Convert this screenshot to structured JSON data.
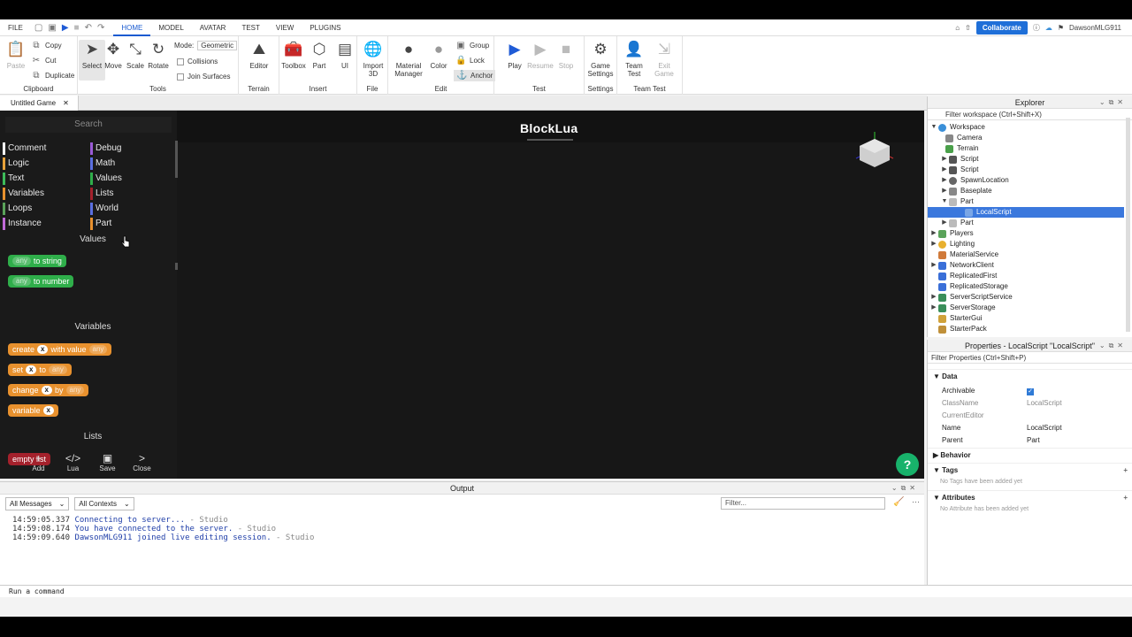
{
  "menubar": {
    "file": "FILE",
    "tabs": [
      "HOME",
      "MODEL",
      "AVATAR",
      "TEST",
      "VIEW",
      "PLUGINS"
    ],
    "collaborate": "Collaborate",
    "username": "DawsonMLG911"
  },
  "ribbon": {
    "clipboard": {
      "label": "Clipboard",
      "paste": "Paste",
      "copy": "Copy",
      "cut": "Cut",
      "duplicate": "Duplicate"
    },
    "tools": {
      "label": "Tools",
      "select": "Select",
      "move": "Move",
      "scale": "Scale",
      "rotate": "Rotate",
      "mode_label": "Mode:",
      "mode_value": "Geometric",
      "collisions": "Collisions",
      "join_surfaces": "Join Surfaces"
    },
    "terrain": {
      "label": "Terrain",
      "editor": "Editor"
    },
    "insert": {
      "label": "Insert",
      "toolbox": "Toolbox",
      "part": "Part",
      "ui": "UI"
    },
    "file": {
      "label": "File",
      "import3d": "Import 3D"
    },
    "edit": {
      "label": "Edit",
      "material_manager": "Material Manager",
      "color": "Color",
      "group": "Group",
      "lock": "Lock",
      "anchor": "Anchor"
    },
    "test": {
      "label": "Test",
      "play": "Play",
      "resume": "Resume",
      "stop": "Stop"
    },
    "settings": {
      "label": "Settings",
      "game_settings": "Game Settings"
    },
    "team_test": {
      "label": "Team Test",
      "team_test": "Team Test",
      "exit_game": "Exit Game"
    }
  },
  "doc_tab": {
    "title": "Untitled Game"
  },
  "viewport": {
    "title": "BlockLua",
    "search_placeholder": "Search",
    "categories": [
      {
        "name": "Comment",
        "color": "#ffffff"
      },
      {
        "name": "Debug",
        "color": "#9a5bd6"
      },
      {
        "name": "Logic",
        "color": "#e8a23a"
      },
      {
        "name": "Math",
        "color": "#5b6fe0"
      },
      {
        "name": "Text",
        "color": "#3dbb5a"
      },
      {
        "name": "Values",
        "color": "#2fae4a"
      },
      {
        "name": "Variables",
        "color": "#e8912e"
      },
      {
        "name": "Lists",
        "color": "#a4212c"
      },
      {
        "name": "Loops",
        "color": "#5aa35a"
      },
      {
        "name": "World",
        "color": "#5b6fe0"
      },
      {
        "name": "Instance",
        "color": "#c06ad8"
      },
      {
        "name": "Part",
        "color": "#e8912e"
      }
    ],
    "sections": {
      "values": "Values",
      "variables": "Variables",
      "lists": "Lists"
    },
    "blocks": {
      "to_string": {
        "slot": "any",
        "text": "to string"
      },
      "to_number": {
        "slot": "any",
        "text": "to number"
      },
      "create": {
        "a": "create",
        "x": "x",
        "b": "with value",
        "slot": "any"
      },
      "set": {
        "a": "set",
        "x": "x",
        "b": "to",
        "slot": "any"
      },
      "change": {
        "a": "change",
        "x": "x",
        "b": "by",
        "slot": "any"
      },
      "variable": {
        "a": "variable",
        "x": "x"
      },
      "empty_list": "empty list"
    },
    "footer": [
      {
        "icon": "+",
        "label": "Add"
      },
      {
        "icon": "</>",
        "label": "Lua"
      },
      {
        "icon": "▣",
        "label": "Save"
      },
      {
        "icon": ">",
        "label": "Close"
      }
    ],
    "help": "?"
  },
  "output": {
    "title": "Output",
    "filter_messages": "All Messages",
    "filter_contexts": "All Contexts",
    "filter_placeholder": "Filter...",
    "lines": [
      {
        "time": "14:59:05.337",
        "msg": "Connecting to server...",
        "src": "-  Studio"
      },
      {
        "time": "14:59:08.174",
        "msg": "You have connected to the server.",
        "src": "-  Studio"
      },
      {
        "time": "14:59:09.640",
        "msg": "DawsonMLG911 joined live editing session.",
        "src": "-  Studio"
      }
    ]
  },
  "command_bar": "Run a command",
  "explorer": {
    "title": "Explorer",
    "filter": "Filter workspace (Ctrl+Shift+X)",
    "items": [
      {
        "label": "Workspace",
        "color": "#3a8fd8"
      },
      {
        "label": "Camera",
        "color": "#888888"
      },
      {
        "label": "Terrain",
        "color": "#4aa04a"
      },
      {
        "label": "Script",
        "color": "#555555"
      },
      {
        "label": "Script",
        "color": "#555555"
      },
      {
        "label": "SpawnLocation",
        "color": "#666666"
      },
      {
        "label": "Baseplate",
        "color": "#888888"
      },
      {
        "label": "Part",
        "color": "#999999"
      },
      {
        "label": "LocalScript",
        "color": "#7aa6e6"
      },
      {
        "label": "Part",
        "color": "#999999"
      },
      {
        "label": "Players",
        "color": "#5aa35a"
      },
      {
        "label": "Lighting",
        "color": "#e8b02e"
      },
      {
        "label": "MaterialService",
        "color": "#d07a3a"
      },
      {
        "label": "NetworkClient",
        "color": "#3a6fd8"
      },
      {
        "label": "ReplicatedFirst",
        "color": "#3a6fd8"
      },
      {
        "label": "ReplicatedStorage",
        "color": "#3a6fd8"
      },
      {
        "label": "ServerScriptService",
        "color": "#3a8f5a"
      },
      {
        "label": "ServerStorage",
        "color": "#3a8f5a"
      },
      {
        "label": "StarterGui",
        "color": "#d0a23a"
      },
      {
        "label": "StarterPack",
        "color": "#c0903a"
      }
    ]
  },
  "properties": {
    "title": "Properties - LocalScript \"LocalScript\"",
    "filter": "Filter Properties (Ctrl+Shift+P)",
    "data_label": "Data",
    "archivable": "Archivable",
    "classname_k": "ClassName",
    "classname_v": "LocalScript",
    "current_editor": "CurrentEditor",
    "name_k": "Name",
    "name_v": "LocalScript",
    "parent_k": "Parent",
    "parent_v": "Part",
    "behavior": "Behavior",
    "tags": "Tags",
    "tags_note": "No Tags have been added yet",
    "attributes": "Attributes",
    "attributes_note": "No Attribute has been added yet"
  }
}
